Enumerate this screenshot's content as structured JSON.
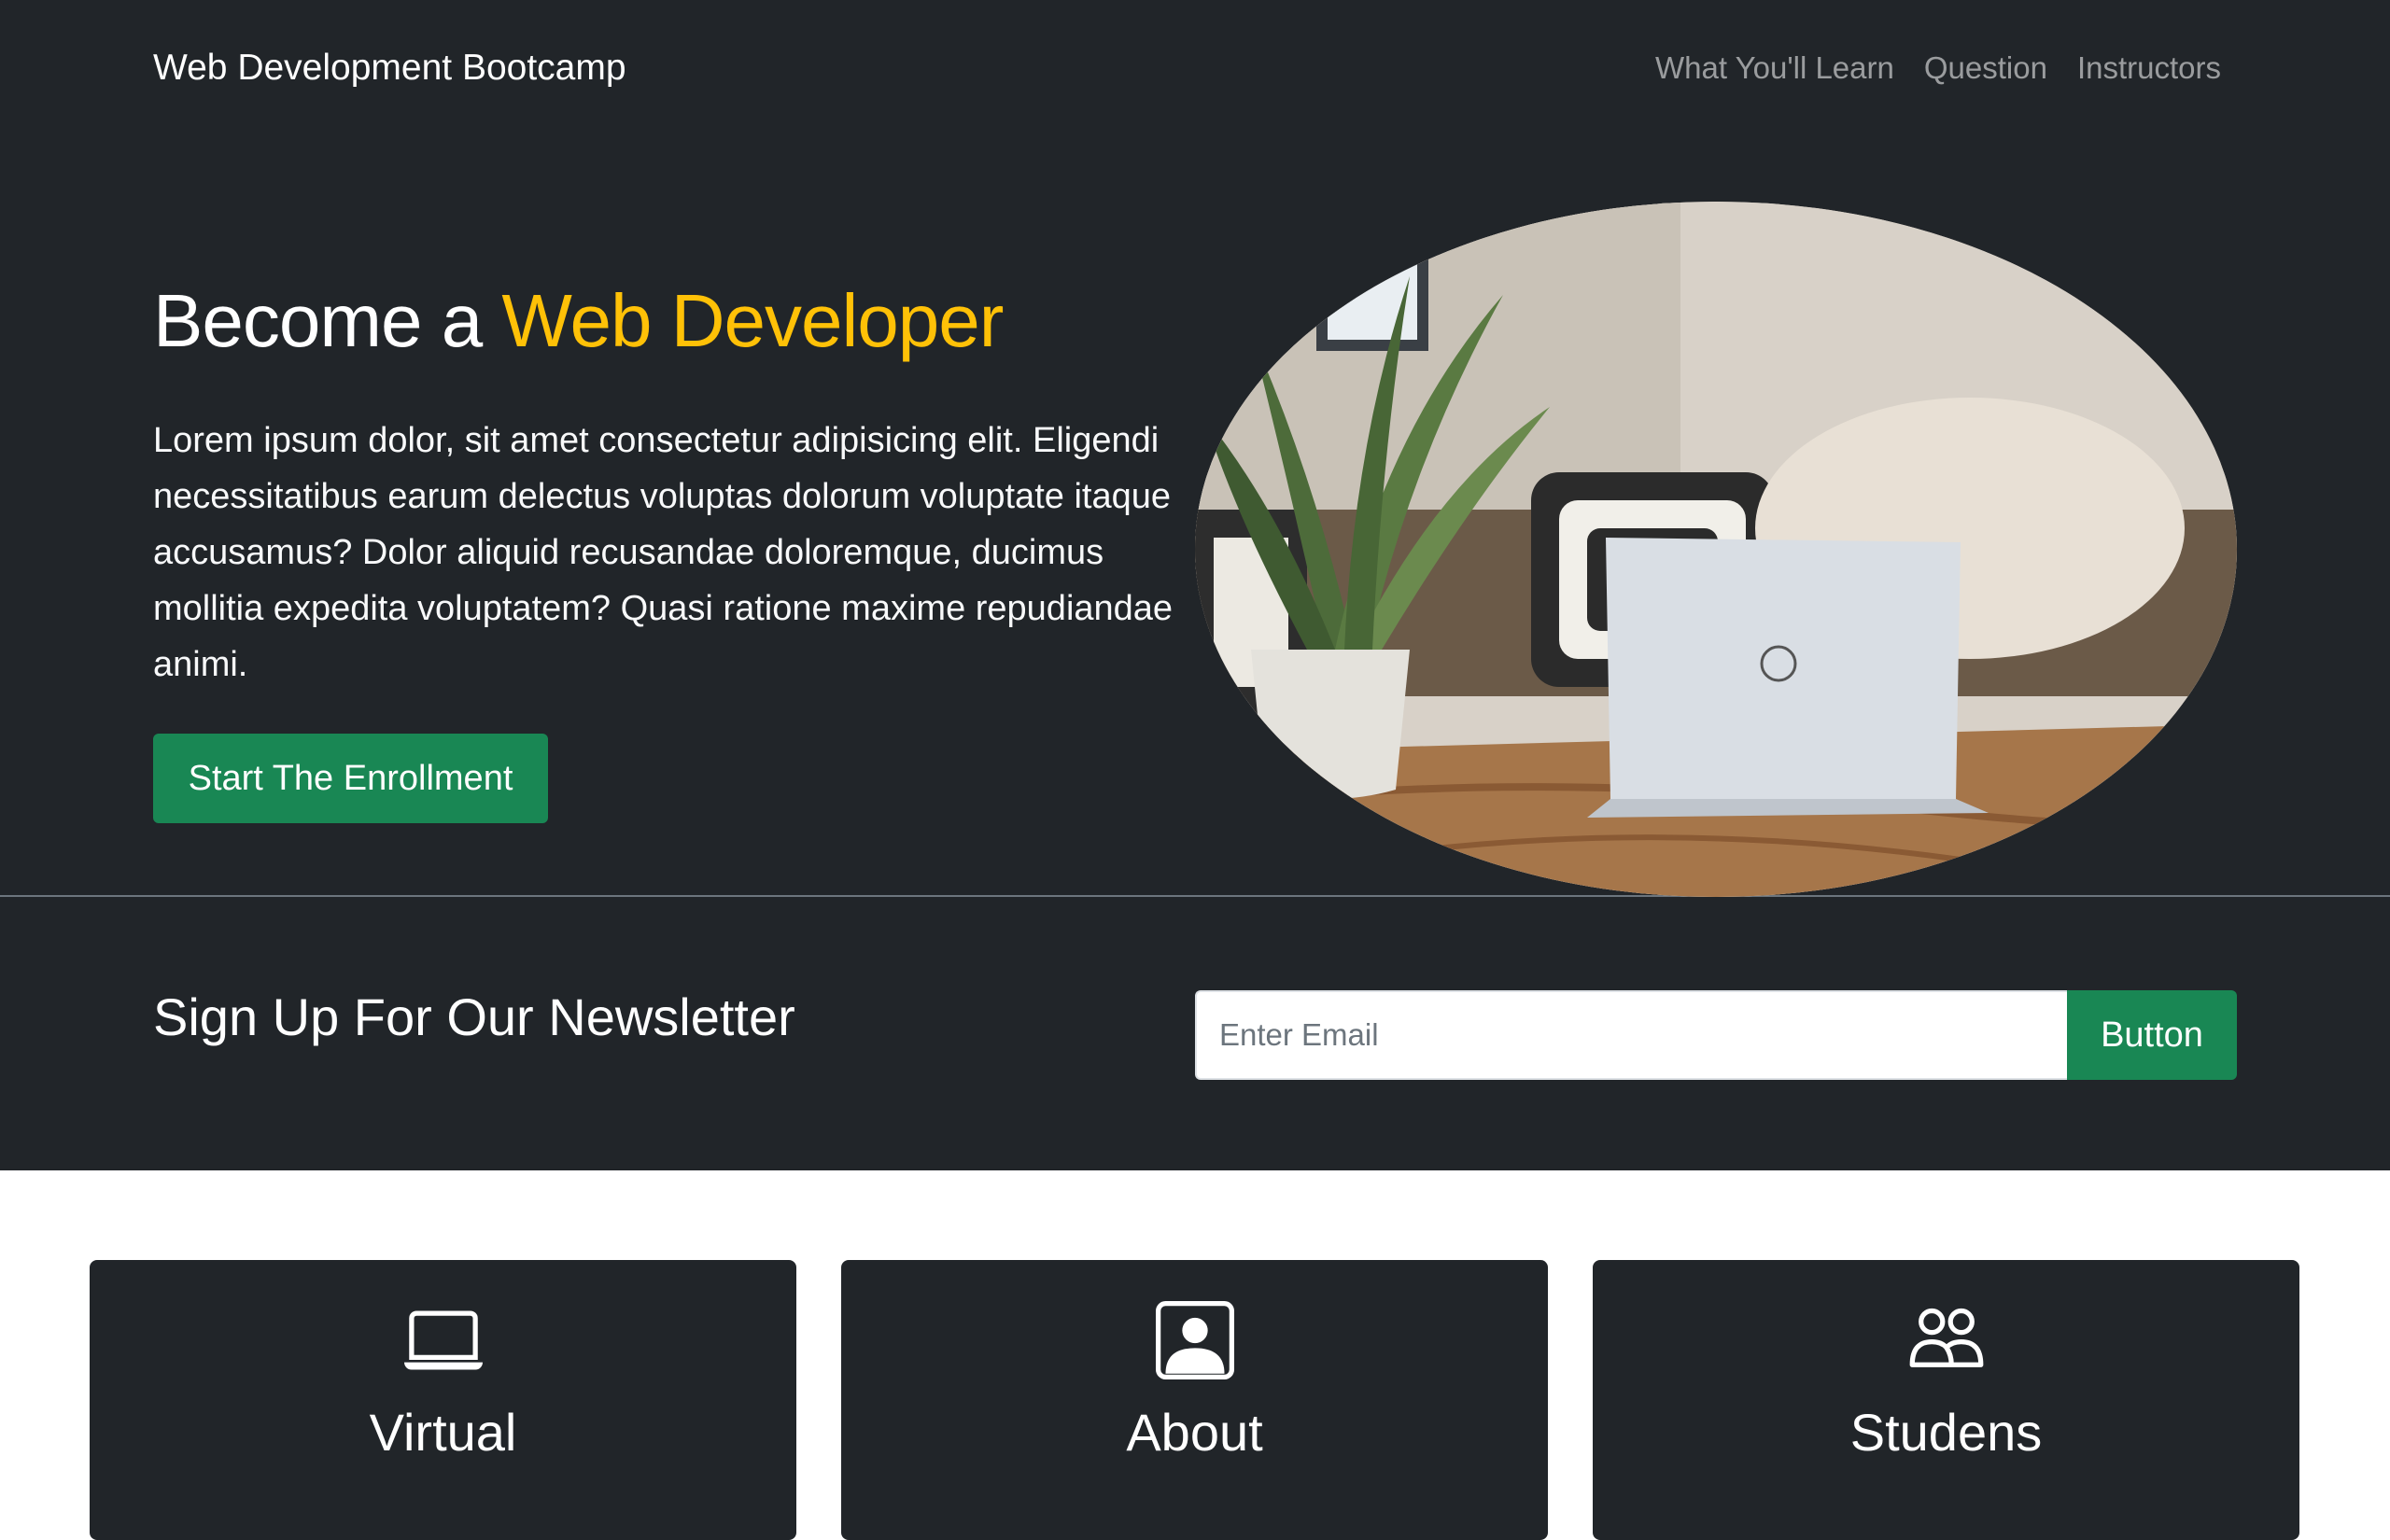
{
  "navbar": {
    "brand": "Web Development Bootcamp",
    "links": [
      "What You'll Learn",
      "Question",
      "Instructors"
    ]
  },
  "hero": {
    "title_prefix": "Become a ",
    "title_accent": "Web Developer",
    "text": "Lorem ipsum dolor, sit amet consectetur adipisicing elit. Eligendi necessitatibus earum delectus voluptas dolorum voluptate itaque accusamus? Dolor aliquid recusandae doloremque, ducimus mollitia expedita voluptatem? Quasi ratione maxime repudiandae animi.",
    "button_label": "Start The Enrollment",
    "image_icon": "laptop-plant-photo"
  },
  "newsletter": {
    "title": "Sign Up For Our Newsletter",
    "email_placeholder": "Enter Email",
    "email_value": "",
    "button_label": "Button"
  },
  "features": [
    {
      "title": "Virtual",
      "icon": "laptop-icon"
    },
    {
      "title": "About",
      "icon": "person-badge-icon"
    },
    {
      "title": "Studens",
      "icon": "people-icon"
    }
  ],
  "colors": {
    "dark": "#212529",
    "accent": "#ffc107",
    "success": "#198754",
    "nav_link": "rgba(255,255,255,0.55)"
  }
}
